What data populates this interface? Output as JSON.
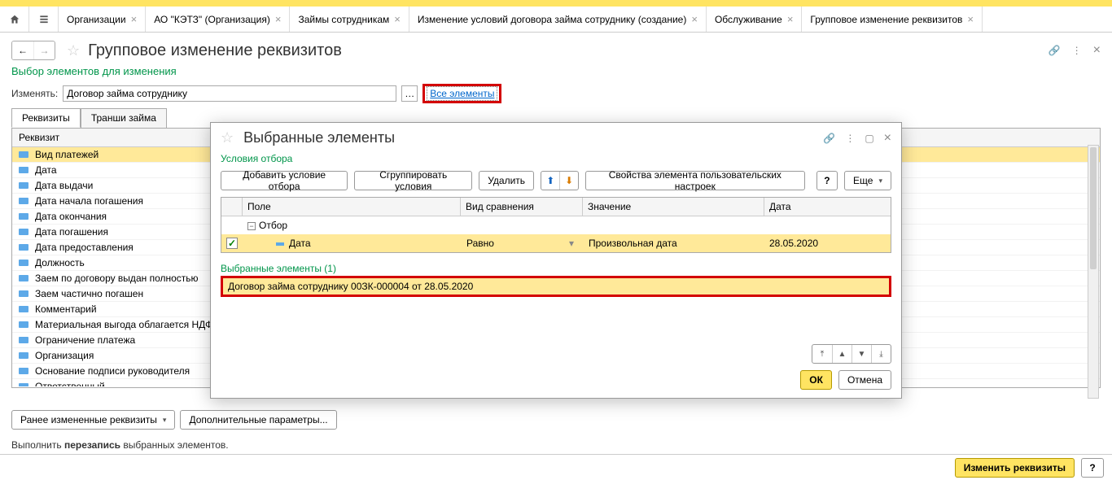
{
  "tabs": [
    "Организации",
    "АО \"КЭТЗ\" (Организация)",
    "Займы сотрудникам",
    "Изменение условий договора займа сотруднику (создание)",
    "Обслуживание",
    "Групповое изменение реквизитов"
  ],
  "page": {
    "title": "Групповое изменение реквизитов"
  },
  "selection_link": "Выбор элементов для изменения",
  "change_label": "Изменять:",
  "change_value": "Договор займа сотруднику",
  "all_elements": "Все элементы",
  "tabstrip": {
    "t1": "Реквизиты",
    "t2": "Транши займа"
  },
  "grid_header": "Реквизит",
  "rows": [
    "Вид платежей",
    "Дата",
    "Дата выдачи",
    "Дата начала погашения",
    "Дата окончания",
    "Дата погашения",
    "Дата предоставления",
    "Должность",
    "Заем по договору выдан полностью",
    "Заем частично погашен",
    "Комментарий",
    "Материальная выгода облагается НДФЛ",
    "Ограничение платежа",
    "Организация",
    "Основание подписи руководителя",
    "Ответственный"
  ],
  "bottom": {
    "b1": "Ранее измененные реквизиты",
    "b2": "Дополнительные параметры..."
  },
  "info_pre": "Выполнить ",
  "info_bold": "перезапись",
  "info_post": " выбранных элементов.",
  "footer": {
    "apply": "Изменить реквизиты",
    "q": "?"
  },
  "dialog": {
    "title": "Выбранные элементы",
    "sub": "Условия отбора",
    "tb": {
      "add": "Добавить условие отбора",
      "group": "Сгруппировать условия",
      "del": "Удалить",
      "props": "Свойства элемента пользовательских настроек",
      "q": "?",
      "more": "Еще"
    },
    "th": {
      "field": "Поле",
      "cmp": "Вид сравнения",
      "val": "Значение",
      "date": "Дата"
    },
    "tree_root": "Отбор",
    "row": {
      "field": "Дата",
      "cmp": "Равно",
      "val": "Произвольная дата",
      "date": "28.05.2020"
    },
    "sel_head": "Выбранные элементы (1)",
    "sel_item": "Договор займа сотруднику 00ЗК-000004 от 28.05.2020",
    "ok": "ОК",
    "cancel": "Отмена"
  }
}
